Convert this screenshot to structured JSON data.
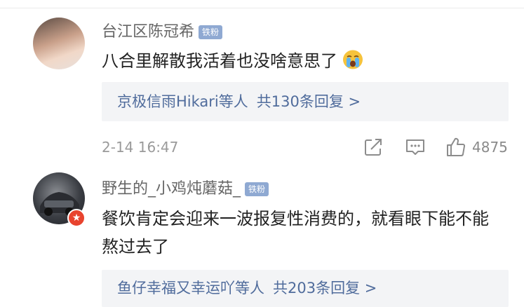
{
  "comments": [
    {
      "username": "台江区陈冠希",
      "badge": "铁粉",
      "text": "八合里解散我活着也没啥意思了",
      "emoji_icon": "crying-face-icon",
      "replies_summary": {
        "names": "京极信雨Hikari等人",
        "count_text": "共130条回复 >"
      },
      "timestamp": "2-14 16:47",
      "like_count": "4875"
    },
    {
      "username": "野生的_小鸡炖蘑菇_",
      "badge": "铁粉",
      "vip_icon": "vip-star-icon",
      "text": "餐饮肯定会迎来一波报复性消费的，就看眼下能不能熬过去了",
      "replies_summary": {
        "names": "鱼仔幸福又幸运吖等人",
        "count_text": "共203条回复 >"
      }
    }
  ],
  "colors": {
    "link_blue": "#506c9c",
    "badge_blue": "#8fa9d2",
    "reply_bg": "#f3f4f6",
    "vip_red": "#e8432e"
  }
}
